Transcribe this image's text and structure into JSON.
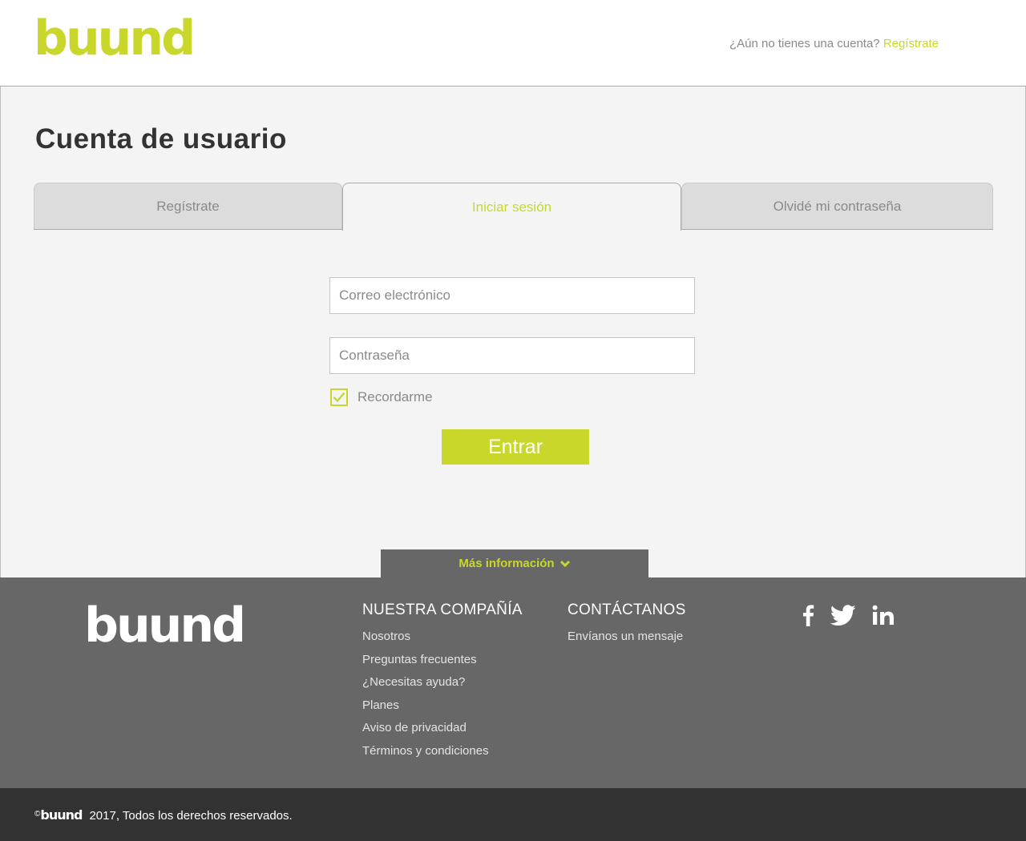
{
  "brand": {
    "logo": "buund",
    "accent": "#c8d72a"
  },
  "header": {
    "signup_prompt": "¿Aún no tienes una cuenta?",
    "signup_link": "Regístrate"
  },
  "main": {
    "title": "Cuenta de usuario",
    "tabs": [
      {
        "label": "Regístrate",
        "active": false
      },
      {
        "label": "Iniciar sesión",
        "active": true
      },
      {
        "label": "Olvidé mi contraseña",
        "active": false
      }
    ],
    "email_placeholder": "Correo electrónico",
    "password_placeholder": "Contraseña",
    "remember_label": "Recordarme",
    "remember_checked": true,
    "submit_label": "Entrar"
  },
  "more_info": {
    "label": "Más información",
    "icon": "chevron-down-icon"
  },
  "footer": {
    "logo": "buund",
    "company": {
      "heading": "NUESTRA COMPAÑÍA",
      "links": [
        "Nosotros",
        "Preguntas frecuentes",
        "¿Necesitas ayuda?",
        "Planes",
        "Aviso de privacidad",
        "Términos y condiciones"
      ]
    },
    "contact": {
      "heading": "CONTÁCTANOS",
      "links": [
        "Envíanos un mensaje"
      ]
    },
    "social": [
      "facebook-icon",
      "twitter-icon",
      "linkedin-icon"
    ]
  },
  "bottom": {
    "copyright_symbol": "©",
    "logo": "buund",
    "text": "2017, Todos los derechos reservados."
  }
}
